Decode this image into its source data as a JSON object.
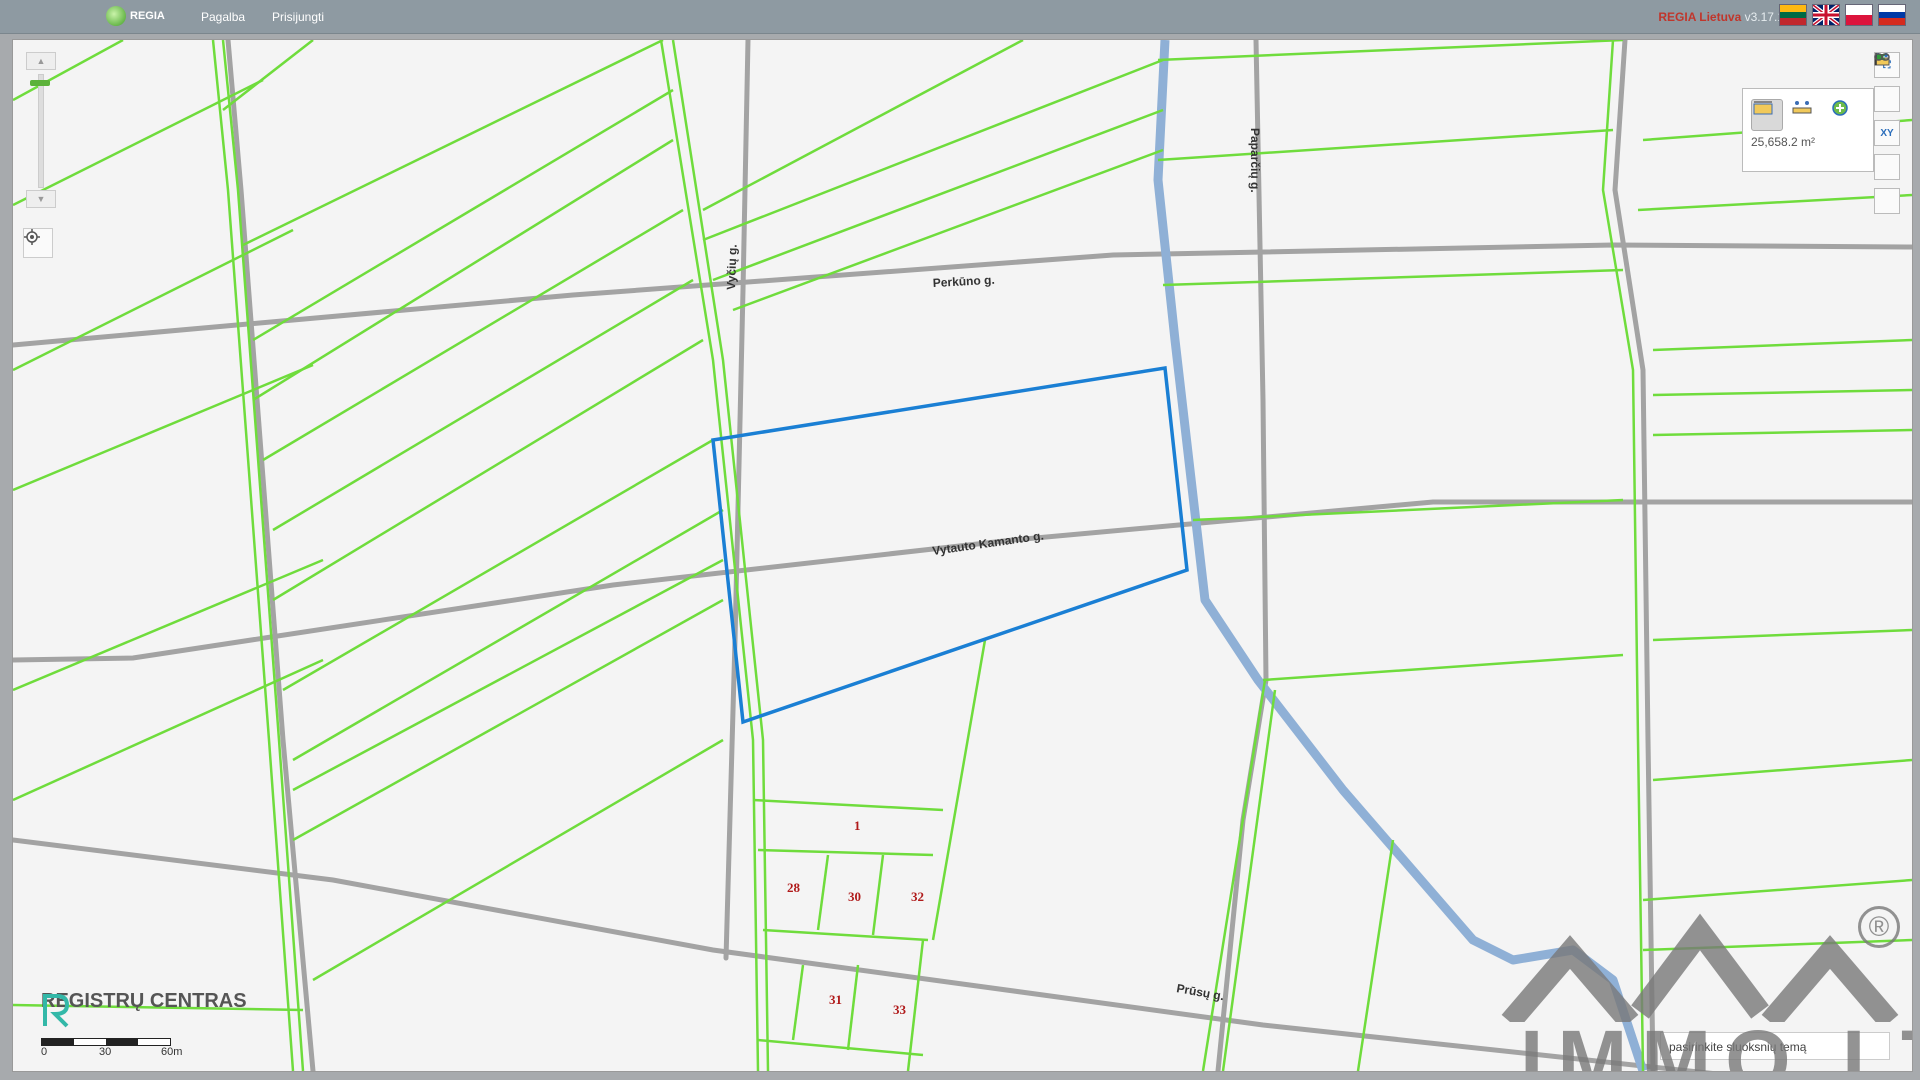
{
  "header": {
    "logo_label": "REGIA",
    "nav": [
      "Pagalba",
      "Prisijungti"
    ],
    "brand": "REGIA Lietuva",
    "version": "v3.17.1",
    "languages": [
      "lt",
      "en",
      "pl",
      "ru"
    ]
  },
  "map": {
    "streets": [
      "Perkūno g.",
      "Vytauto Kamanto g.",
      "Vyčių g.",
      "Paparčių g.",
      "Prūsų g."
    ],
    "parcel_numbers": [
      "1",
      "28",
      "30",
      "32",
      "31",
      "33"
    ],
    "measurement": "25,658.2 m²",
    "selected_parcel_color": "#1a7fd4",
    "parcel_line_color": "#6fdc3c",
    "road_color": "#a3a3a3",
    "river_color": "#8fb0d6",
    "scale_labels": [
      "0",
      "30",
      "60m"
    ],
    "theme_selector": "pasirinkite sluoksnių temą",
    "provider_logo": "REGISTRŲ CENTRAS",
    "watermark": "IMMO.LT",
    "watermark_mark": "®"
  },
  "icons": {
    "zoom_in": "chevron-up-icon",
    "zoom_out": "chevron-down-icon",
    "locate": "locate-icon",
    "measure_area": "measure-area-icon",
    "measure_distance": "measure-distance-icon",
    "add": "add-icon",
    "fullscreen": "fullscreen-icon",
    "layers": "layers-icon",
    "coordinates": "xy-icon",
    "flag": "flag-icon",
    "link": "link-icon"
  }
}
